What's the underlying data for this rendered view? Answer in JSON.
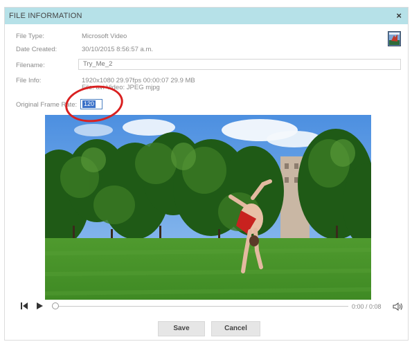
{
  "dialog": {
    "title": "FILE INFORMATION",
    "close_label": "×"
  },
  "fields": {
    "file_type_label": "File Type:",
    "file_type_value": "Microsoft Video",
    "date_created_label": "Date Created:",
    "date_created_value": "30/10/2015 8:56:57 a.m.",
    "filename_label": "Filename:",
    "filename_value": "Try_Me_2",
    "file_info_label": "File Info:",
    "file_info_line1": "1920x1080  29.97fps  00:00:07  29.9 MB",
    "file_info_line2": "File: avi Video: JPEG mjpg",
    "original_frame_rate_label": "Original Frame Rate:",
    "original_frame_rate_value": "120"
  },
  "player": {
    "time_display": "0:00 / 0:08",
    "progress": 0
  },
  "buttons": {
    "save_label": "Save",
    "cancel_label": "Cancel"
  },
  "colors": {
    "titlebar": "#b6e1e8",
    "annotation": "#d92020",
    "selection": "#3a70c8"
  },
  "icons": [
    "file-thumbnail-icon",
    "skip-back-icon",
    "play-icon",
    "volume-icon",
    "close-icon"
  ]
}
